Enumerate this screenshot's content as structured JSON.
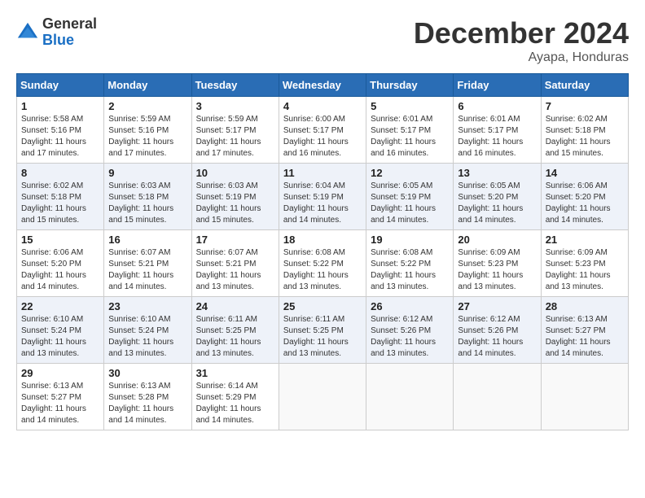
{
  "header": {
    "logo_general": "General",
    "logo_blue": "Blue",
    "month_title": "December 2024",
    "location": "Ayapa, Honduras"
  },
  "days_of_week": [
    "Sunday",
    "Monday",
    "Tuesday",
    "Wednesday",
    "Thursday",
    "Friday",
    "Saturday"
  ],
  "weeks": [
    [
      {
        "day": "1",
        "sunrise": "5:58 AM",
        "sunset": "5:16 PM",
        "daylight": "11 hours and 17 minutes."
      },
      {
        "day": "2",
        "sunrise": "5:59 AM",
        "sunset": "5:16 PM",
        "daylight": "11 hours and 17 minutes."
      },
      {
        "day": "3",
        "sunrise": "5:59 AM",
        "sunset": "5:17 PM",
        "daylight": "11 hours and 17 minutes."
      },
      {
        "day": "4",
        "sunrise": "6:00 AM",
        "sunset": "5:17 PM",
        "daylight": "11 hours and 16 minutes."
      },
      {
        "day": "5",
        "sunrise": "6:01 AM",
        "sunset": "5:17 PM",
        "daylight": "11 hours and 16 minutes."
      },
      {
        "day": "6",
        "sunrise": "6:01 AM",
        "sunset": "5:17 PM",
        "daylight": "11 hours and 16 minutes."
      },
      {
        "day": "7",
        "sunrise": "6:02 AM",
        "sunset": "5:18 PM",
        "daylight": "11 hours and 15 minutes."
      }
    ],
    [
      {
        "day": "8",
        "sunrise": "6:02 AM",
        "sunset": "5:18 PM",
        "daylight": "11 hours and 15 minutes."
      },
      {
        "day": "9",
        "sunrise": "6:03 AM",
        "sunset": "5:18 PM",
        "daylight": "11 hours and 15 minutes."
      },
      {
        "day": "10",
        "sunrise": "6:03 AM",
        "sunset": "5:19 PM",
        "daylight": "11 hours and 15 minutes."
      },
      {
        "day": "11",
        "sunrise": "6:04 AM",
        "sunset": "5:19 PM",
        "daylight": "11 hours and 14 minutes."
      },
      {
        "day": "12",
        "sunrise": "6:05 AM",
        "sunset": "5:19 PM",
        "daylight": "11 hours and 14 minutes."
      },
      {
        "day": "13",
        "sunrise": "6:05 AM",
        "sunset": "5:20 PM",
        "daylight": "11 hours and 14 minutes."
      },
      {
        "day": "14",
        "sunrise": "6:06 AM",
        "sunset": "5:20 PM",
        "daylight": "11 hours and 14 minutes."
      }
    ],
    [
      {
        "day": "15",
        "sunrise": "6:06 AM",
        "sunset": "5:20 PM",
        "daylight": "11 hours and 14 minutes."
      },
      {
        "day": "16",
        "sunrise": "6:07 AM",
        "sunset": "5:21 PM",
        "daylight": "11 hours and 14 minutes."
      },
      {
        "day": "17",
        "sunrise": "6:07 AM",
        "sunset": "5:21 PM",
        "daylight": "11 hours and 13 minutes."
      },
      {
        "day": "18",
        "sunrise": "6:08 AM",
        "sunset": "5:22 PM",
        "daylight": "11 hours and 13 minutes."
      },
      {
        "day": "19",
        "sunrise": "6:08 AM",
        "sunset": "5:22 PM",
        "daylight": "11 hours and 13 minutes."
      },
      {
        "day": "20",
        "sunrise": "6:09 AM",
        "sunset": "5:23 PM",
        "daylight": "11 hours and 13 minutes."
      },
      {
        "day": "21",
        "sunrise": "6:09 AM",
        "sunset": "5:23 PM",
        "daylight": "11 hours and 13 minutes."
      }
    ],
    [
      {
        "day": "22",
        "sunrise": "6:10 AM",
        "sunset": "5:24 PM",
        "daylight": "11 hours and 13 minutes."
      },
      {
        "day": "23",
        "sunrise": "6:10 AM",
        "sunset": "5:24 PM",
        "daylight": "11 hours and 13 minutes."
      },
      {
        "day": "24",
        "sunrise": "6:11 AM",
        "sunset": "5:25 PM",
        "daylight": "11 hours and 13 minutes."
      },
      {
        "day": "25",
        "sunrise": "6:11 AM",
        "sunset": "5:25 PM",
        "daylight": "11 hours and 13 minutes."
      },
      {
        "day": "26",
        "sunrise": "6:12 AM",
        "sunset": "5:26 PM",
        "daylight": "11 hours and 13 minutes."
      },
      {
        "day": "27",
        "sunrise": "6:12 AM",
        "sunset": "5:26 PM",
        "daylight": "11 hours and 14 minutes."
      },
      {
        "day": "28",
        "sunrise": "6:13 AM",
        "sunset": "5:27 PM",
        "daylight": "11 hours and 14 minutes."
      }
    ],
    [
      {
        "day": "29",
        "sunrise": "6:13 AM",
        "sunset": "5:27 PM",
        "daylight": "11 hours and 14 minutes."
      },
      {
        "day": "30",
        "sunrise": "6:13 AM",
        "sunset": "5:28 PM",
        "daylight": "11 hours and 14 minutes."
      },
      {
        "day": "31",
        "sunrise": "6:14 AM",
        "sunset": "5:29 PM",
        "daylight": "11 hours and 14 minutes."
      },
      null,
      null,
      null,
      null
    ]
  ]
}
